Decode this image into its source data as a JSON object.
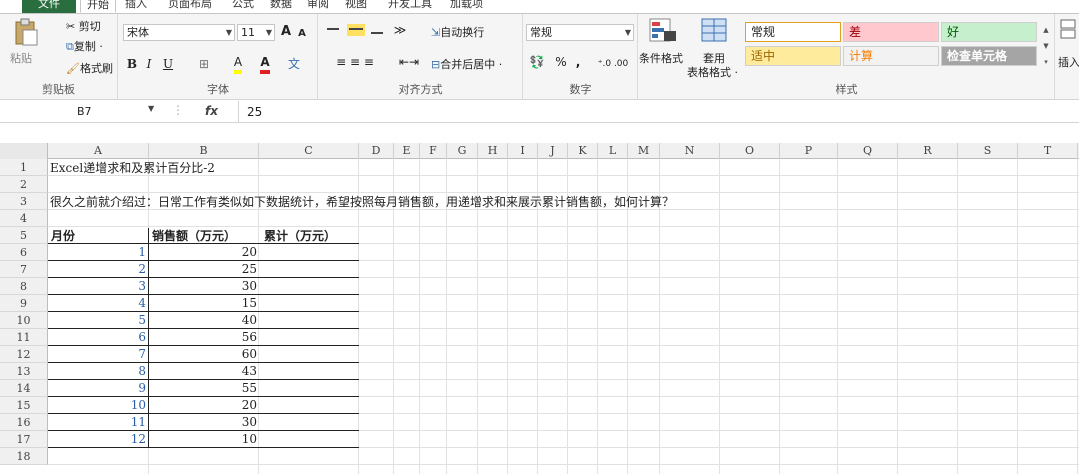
{
  "tabs": [
    "文件",
    "开始",
    "插入",
    "页面布局",
    "公式",
    "数据",
    "审阅",
    "视图",
    "开发工具",
    "加载项"
  ],
  "ribbon": {
    "clipboard": {
      "paste": "粘贴",
      "cut": "剪切",
      "copy": "复制 ·",
      "format_painter": "格式刷",
      "label": "剪贴板"
    },
    "font": {
      "font_name": "宋体",
      "font_size": "11",
      "grow": "A",
      "shrink": "A",
      "bold": "B",
      "italic": "I",
      "underline": "U",
      "fill_letter": "A",
      "font_color_letter": "A",
      "phonetic": "文",
      "label": "字体"
    },
    "alignment": {
      "wrap_text": "自动换行",
      "merge_center": "合并后居中 ·",
      "label": "对齐方式"
    },
    "number": {
      "format": "常规",
      "percent": "%",
      "comma": ",",
      "label": "数字"
    },
    "styles": {
      "conditional": "条件格式",
      "table_format_top": "套用",
      "table_format_bottom": "表格格式 ·",
      "normal": "常规",
      "bad": "差",
      "good": "好",
      "neutral": "适中",
      "calculation": "计算",
      "check_cell": "检查单元格",
      "label": "样式",
      "colors": {
        "bad_bg": "#ffc7ce",
        "bad_fg": "#9c0006",
        "good_bg": "#c6efce",
        "good_fg": "#006100",
        "neutral_bg": "#ffeb9c",
        "neutral_fg": "#9c6500",
        "calc_bg": "#f2f2f2",
        "calc_fg": "#fa7d00",
        "check_bg": "#a5a5a5",
        "check_fg": "#ffffff"
      }
    },
    "insert_label": "插入"
  },
  "formula_bar": {
    "name_box": "B7",
    "fx": "fx",
    "content": "25"
  },
  "columns": [
    "A",
    "B",
    "C",
    "D",
    "E",
    "F",
    "G",
    "H",
    "I",
    "J",
    "K",
    "L",
    "M",
    "N",
    "O",
    "P",
    "Q",
    "R",
    "S",
    "T"
  ],
  "rows": [
    "1",
    "2",
    "3",
    "4",
    "5",
    "6",
    "7",
    "8",
    "9",
    "10",
    "11",
    "12",
    "13",
    "14",
    "15",
    "16",
    "17",
    "18"
  ],
  "sheet": {
    "a1": "Excel递增求和及累计百分比-2",
    "a3": "很久之前就介绍过：日常工作有类似如下数据统计，希望按照每月销售额，用递增求和来展示累计销售额，如何计算？",
    "header_month": "月份",
    "header_sales": "销售额（万元）",
    "header_cumulative": "累计（万元）",
    "months": [
      "1",
      "2",
      "3",
      "4",
      "5",
      "6",
      "7",
      "8",
      "9",
      "10",
      "11",
      "12"
    ],
    "sales": [
      "20",
      "25",
      "30",
      "15",
      "40",
      "56",
      "60",
      "43",
      "55",
      "20",
      "30",
      "10"
    ]
  }
}
